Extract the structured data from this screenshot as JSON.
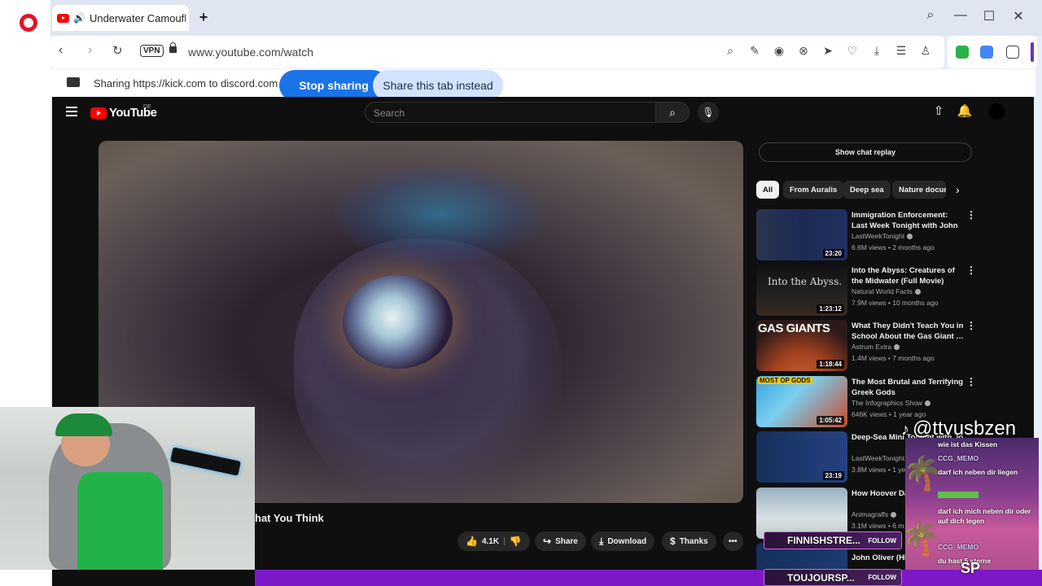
{
  "browser": {
    "tab_title": "Underwater Camoufla",
    "url": "www.youtube.com/watch",
    "vpn_label": "VPN"
  },
  "sharing": {
    "text": "Sharing https://kick.com to discord.com",
    "stop_label": "Stop sharing",
    "share_tab_label": "Share this tab instead"
  },
  "youtube": {
    "logo_text": "YouTube",
    "country": "DE",
    "search_placeholder": "Search",
    "video_title": "hat You Think",
    "actions": {
      "likes": "4.1K",
      "share": "Share",
      "download": "Download",
      "thanks": "Thanks"
    },
    "chat_replay": "Show chat replay",
    "chips": [
      "All",
      "From Auralis",
      "Deep sea",
      "Nature docum"
    ],
    "recommendations": [
      {
        "title": "Immigration Enforcement: Last Week Tonight with John Oliver…",
        "channel": "LastWeekTonight",
        "meta": "6.6M views • 2 months ago",
        "duration": "23:20"
      },
      {
        "title": "Into the Abyss: Creatures of the Midwater (Full Movie)",
        "channel": "Natural World Facts",
        "meta": "7.9M views • 10 months ago",
        "duration": "1:23:12",
        "thumb_text": "Into the Abyss."
      },
      {
        "title": "What They Didn't Teach You in School About the Gas Giant …",
        "channel": "Astrum Extra",
        "meta": "1.4M views • 7 months ago",
        "duration": "1:18:44",
        "thumb_text": "GAS GIANTS"
      },
      {
        "title": "The Most Brutal and Terrifying Greek Gods",
        "channel": "The Infographics Show",
        "meta": "646K views • 1 year ago",
        "duration": "1:05:42",
        "thumb_text": "MOST OP GODS"
      },
      {
        "title": "Deep-Sea Mini Tonight with Jo",
        "channel": "LastWeekTonight",
        "meta": "3.8M views • 1 ye",
        "duration": "23:19"
      },
      {
        "title": "How Hoover Da",
        "channel": "Animagraffs",
        "meta": "3.1M views • 6 m",
        "duration": ""
      },
      {
        "title": "John Oliver (HE",
        "channel": "",
        "meta": "",
        "duration": ""
      }
    ]
  },
  "overlay": {
    "tiktok_handle": "@ttvusbzen",
    "chat": [
      {
        "text": "wie ist das Kissen"
      },
      {
        "user": "CCG_MEMO"
      },
      {
        "text": "darf ich neben dir liegen"
      },
      {
        "text": "darf ich mich neben dir oder auf dich legen"
      },
      {
        "user": "CCG_MEMO"
      },
      {
        "text": "du hast 5 sterne"
      }
    ],
    "alert_1": "FINNISHSTRE...",
    "alert_2": "TOUJOURSP...",
    "follow_label": "FOLLOW",
    "sp_logo": "SP"
  },
  "colors": {
    "opera_red": "#e3122b",
    "stop_button": "#1a73e8",
    "share_tab_button": "#d3e3fd",
    "yt_bg": "#0f0f0f",
    "yt_red": "#ff0000",
    "kick_purple": "#7d18c9"
  }
}
